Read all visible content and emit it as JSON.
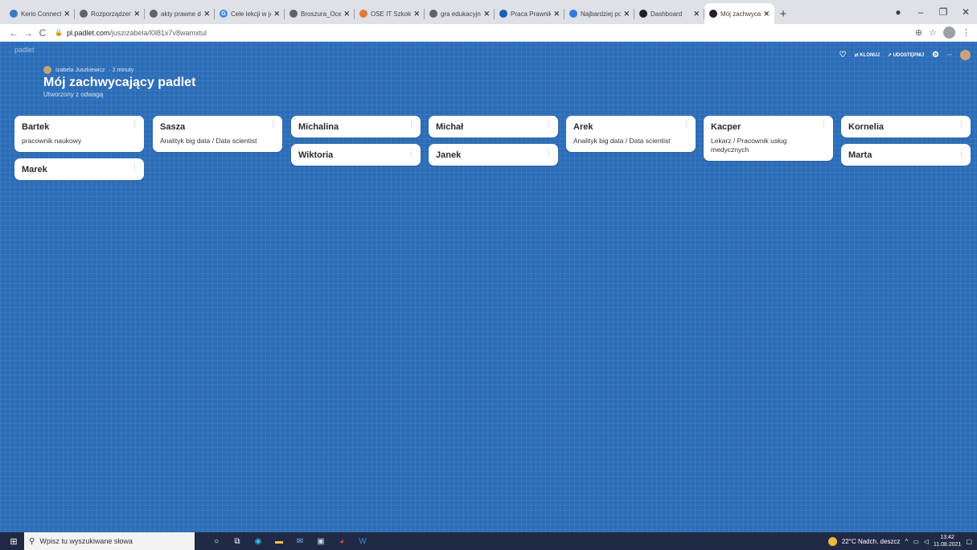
{
  "browser": {
    "tabs": [
      {
        "title": "Kerio Connect C",
        "favicon_color": "#3b78c6",
        "favicon_char": ""
      },
      {
        "title": "Rozporządzenie",
        "favicon_color": "#5f6368",
        "favicon_char": ""
      },
      {
        "title": "akty prawne do",
        "favicon_color": "#5f6368",
        "favicon_char": ""
      },
      {
        "title": "Cele lekcji w jez",
        "favicon_color": "#4285f4",
        "favicon_char": "G"
      },
      {
        "title": "Broszura_Ocen",
        "favicon_color": "#5f6368",
        "favicon_char": ""
      },
      {
        "title": "OSE IT Szkoła",
        "favicon_color": "#e07a3b",
        "favicon_char": ""
      },
      {
        "title": "gra edukacyjna",
        "favicon_color": "#5f6368",
        "favicon_char": ""
      },
      {
        "title": "Praca Prawnik",
        "favicon_color": "#1a5fb4",
        "favicon_char": ""
      },
      {
        "title": "Najbardziej poś",
        "favicon_color": "#2f7be0",
        "favicon_char": ""
      },
      {
        "title": "Dashboard",
        "favicon_color": "#202124",
        "favicon_char": ""
      },
      {
        "title": "Mój zachwycają",
        "favicon_color": "#202124",
        "favicon_char": ""
      }
    ],
    "active_tab_index": 10,
    "new_tab": "+",
    "window_controls": {
      "record": "●",
      "minimize": "–",
      "restore": "❐",
      "close": "✕"
    },
    "url": {
      "host": "pl.padlet.com",
      "path": "/juszizabela/l0l81x7v8wamxtul"
    },
    "nav": {
      "back": "←",
      "forward": "→",
      "reload": "C"
    }
  },
  "padlet": {
    "brand": "padlet",
    "author": "Izabela Juszkiewicz",
    "time": "· 2 minuty",
    "title": "Mój zachwycający padlet",
    "subtitle": "Utworzony z odwagą",
    "actions": {
      "clone": "KLONUJ",
      "share": "UDOSTĘPNIJ",
      "more": "···"
    },
    "columns": [
      [
        {
          "name": "Bartek",
          "desc": "pracownik naukowy"
        },
        {
          "name": "Marek",
          "desc": ""
        }
      ],
      [
        {
          "name": "Sasza",
          "desc": "Analityk big data / Data scientist"
        }
      ],
      [
        {
          "name": "Michalina",
          "desc": ""
        },
        {
          "name": "Wiktoria",
          "desc": ""
        }
      ],
      [
        {
          "name": "Michał",
          "desc": ""
        },
        {
          "name": "Janek",
          "desc": ""
        }
      ],
      [
        {
          "name": "Arek",
          "desc": "Analityk big data / Data scientist"
        }
      ],
      [
        {
          "name": "Kacper",
          "desc": "Lekarz / Pracownik usług medycznych"
        }
      ],
      [
        {
          "name": "Kornelia",
          "desc": ""
        },
        {
          "name": "Marta",
          "desc": ""
        }
      ]
    ],
    "fab_label": "+"
  },
  "taskbar": {
    "search_placeholder": "Wpisz tu wyszukiwane słowa",
    "weather": "22°C Nadch. deszcz",
    "time": "13:42",
    "date": "11.08.2021"
  },
  "colors": {
    "canvas": "#2c6db8",
    "fab": "#ef4b6d",
    "taskbar": "#202a44"
  }
}
